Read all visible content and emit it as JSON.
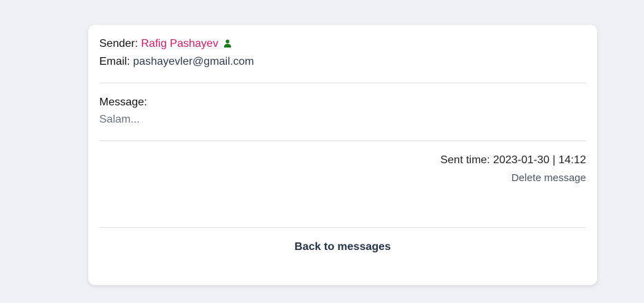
{
  "sender": {
    "label": "Sender:",
    "name": "Rafig Pashayev",
    "icon": "user-icon",
    "icon_color": "#1a7a1a",
    "name_color": "#d6186b"
  },
  "email": {
    "label": "Email:",
    "value": "pashayevler@gmail.com"
  },
  "message": {
    "label": "Message:",
    "body": "Salam..."
  },
  "meta": {
    "sent_time": "Sent time: 2023-01-30 | 14:12",
    "delete_label": "Delete message"
  },
  "footer": {
    "back_label": "Back to messages"
  }
}
